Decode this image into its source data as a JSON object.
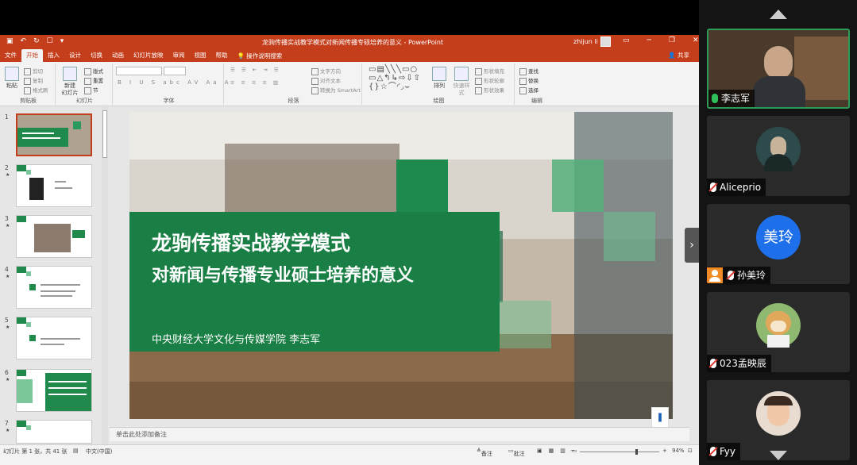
{
  "app": {
    "window_title": "龙驹传播实战教学模式对新闻传播专硕培养的意义  -  PowerPoint",
    "user": "zhijun li",
    "quick_access": [
      "▣",
      "↶",
      "↻",
      "☐",
      "▾"
    ],
    "window_controls": [
      "▭",
      "─",
      "❐",
      "✕"
    ]
  },
  "tabs": [
    "文件",
    "开始",
    "插入",
    "设计",
    "切换",
    "动画",
    "幻灯片放映",
    "审阅",
    "视图",
    "帮助"
  ],
  "active_tab": "开始",
  "tell_me": "操作说明搜索",
  "share": "共享",
  "ribbon": {
    "groups": {
      "clipboard": "剪贴板",
      "slides": "幻灯片",
      "font": "字体",
      "paragraph": "段落",
      "drawing": "绘图",
      "editing": "编辑"
    },
    "paste": "粘贴",
    "cut": "剪切",
    "copy": "复制",
    "format_painter": "格式刷",
    "new_slide": "新建\n幻灯片",
    "layout": "版式",
    "reset": "重置",
    "section": "节",
    "text_direction": "文字方向",
    "align_text": "对齐文本",
    "smartart": "转换为 SmartArt",
    "arrange": "排列",
    "quick_styles": "快速样式",
    "shape_fill": "形状填充",
    "shape_outline": "形状轮廓",
    "shape_effects": "形状效果",
    "find": "查找",
    "replace": "替换",
    "select": "选择"
  },
  "thumbnails": [
    {
      "num": "1",
      "star": ""
    },
    {
      "num": "2",
      "star": "★"
    },
    {
      "num": "3",
      "star": "★"
    },
    {
      "num": "4",
      "star": "★"
    },
    {
      "num": "5",
      "star": "★"
    },
    {
      "num": "6",
      "star": "★"
    },
    {
      "num": "7",
      "star": "★"
    }
  ],
  "slide": {
    "title": "龙驹传播实战教学模式",
    "subtitle": "对新闻与传播专业硕士培养的意义",
    "author": "中央财经大学文化与传媒学院  李志军"
  },
  "notes_placeholder": "单击此处添加备注",
  "status": {
    "slide_count": "幻灯片 第 1 张，共 41 张",
    "language": "中文(中国)",
    "notes": "备注",
    "comments": "批注",
    "zoom": "94%"
  },
  "participants": [
    {
      "name": "李志军",
      "mic": "on",
      "video": true
    },
    {
      "name": "Aliceprio",
      "mic": "off"
    },
    {
      "name": "孙美玲",
      "mic": "off",
      "avatar_text": "美玲",
      "host": true
    },
    {
      "name": "023孟映辰",
      "mic": "off"
    },
    {
      "name": "Fyy",
      "mic": "off"
    }
  ],
  "colors": {
    "ppt_accent": "#c43e1c",
    "slide_green": "#1a7f45",
    "avatar_blue": "#1e6fea",
    "active_border": "#2d9c58"
  }
}
